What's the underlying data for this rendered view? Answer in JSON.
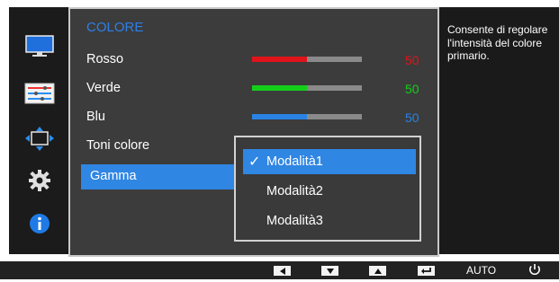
{
  "menu": {
    "section_title": "COLORE",
    "rows": [
      {
        "label": "Rosso",
        "value": "50",
        "level": 0.5,
        "color": "#e0141a"
      },
      {
        "label": "Verde",
        "value": "50",
        "level": 0.5,
        "color": "#14cf1a"
      },
      {
        "label": "Blu",
        "value": "50",
        "level": 0.5,
        "color": "#2a83e4"
      }
    ],
    "toni_colore_label": "Toni colore",
    "gamma_label": "Gamma"
  },
  "dropdown": {
    "options": [
      "Modalità1",
      "Modalità2",
      "Modalità3"
    ],
    "selected": "Modalità1"
  },
  "help_text": "Consente di regolare l'intensità del colore primario.",
  "sidebar": {
    "icons": [
      "monitor-icon",
      "color-sliders-icon",
      "size-position-icon",
      "settings-gear-icon",
      "info-icon"
    ],
    "selected_icon": "color-sliders-icon"
  },
  "bottom_bar": {
    "auto_label": "AUTO",
    "buttons": [
      "left-arrow-icon",
      "down-arrow-icon",
      "up-arrow-icon",
      "enter-icon",
      "power-icon"
    ]
  },
  "colors": {
    "accent_blue": "#2f86e3",
    "panel_bg": "#3c3c3c",
    "rail_bg": "#1b1b1b"
  }
}
